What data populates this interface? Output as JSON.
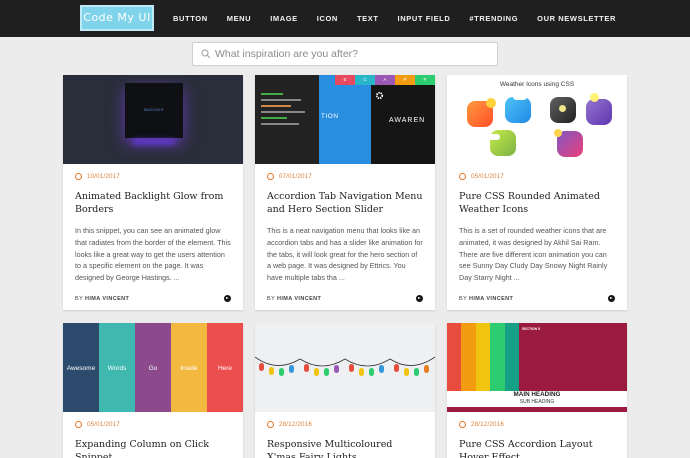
{
  "header": {
    "logo_text": "Code My UI",
    "nav": [
      "BUTTON",
      "MENU",
      "IMAGE",
      "ICON",
      "TEXT",
      "INPUT FIELD",
      "#TRENDING",
      "OUR NEWSLETTER"
    ]
  },
  "search": {
    "placeholder": "What inspiration are you after?"
  },
  "cards": [
    {
      "date": "10/01/2017",
      "title": "Animated Backlight Glow from Borders",
      "excerpt": "In this snippet, you can see an animated glow that radiates from the border of the element. This looks like a great way to get the users attention to a specific element on the page. It was designed by George Hastings. ...",
      "author_prefix": "BY",
      "author": "HIMA VINCENT",
      "thumb_text": "BACKLIGHT"
    },
    {
      "date": "07/01/2017",
      "title": "Accordion Tab Navigation Menu and Hero Section Slider",
      "excerpt": "This is a neat navigation menu that looks like an accordion tabs and has a slider like animation for the tabs, it will look great for the hero section of a web page. It was designed by Ettrics. You have multiple tabs tha ...",
      "author_prefix": "BY",
      "author": "HIMA VINCENT",
      "thumb_tabs": [
        "E",
        "C",
        "A",
        "P",
        "P"
      ],
      "thumb_text_left": "TION",
      "thumb_text_right": "AWAREN"
    },
    {
      "date": "05/01/2017",
      "title": "Pure CSS Rounded Animated Weather Icons",
      "excerpt": "This is a set of rounded weather icons that are animated, it was designed by Akhil Sai Ram. There are five different icon animation you can see Sunny Day Cludy Day Snowy Night Rainly Day Starry Night ...",
      "author_prefix": "BY",
      "author": "HIMA VINCENT",
      "thumb_text": "Weather Icons using CSS"
    },
    {
      "date": "05/01/2017",
      "title": "Expanding Column on Click Snippet",
      "thumb_labels": [
        "Awesome",
        "Words",
        "Go",
        "Inside",
        "Here"
      ]
    },
    {
      "date": "28/12/2016",
      "title": "Responsive Multicoloured X'mas Fairy Lights"
    },
    {
      "date": "28/12/2016",
      "title": "Pure CSS Accordion Layout Hover Effect",
      "thumb_section": "SECTION 5",
      "thumb_heading": "MAIN HEADING",
      "thumb_subheading": "SUB HEADING"
    }
  ],
  "colors": {
    "accent": "#e07a2c",
    "header_bg": "#1f1f1f",
    "logo_bg": "#7fd3ea"
  }
}
